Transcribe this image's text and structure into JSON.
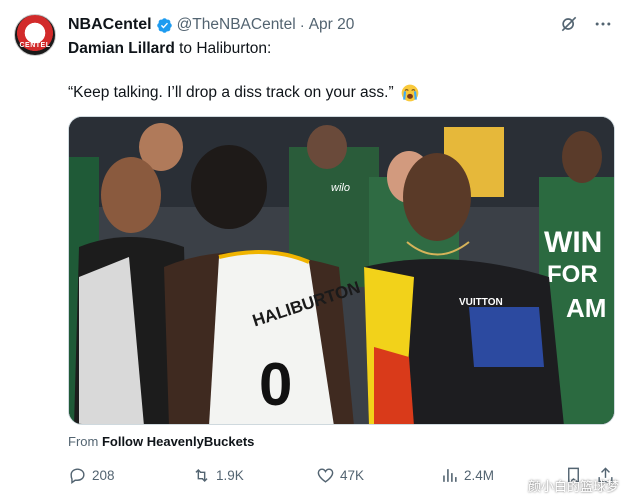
{
  "post": {
    "display_name": "NBACentel",
    "handle": "@TheNBACentel",
    "separator": "·",
    "time": "Apr 20",
    "avatar_text": "CENTEL",
    "line1_name": "Damian Lillard",
    "line1_rest": " to Haliburton:",
    "quote": "“Keep talking. I’ll drop a diss track on your ass.”",
    "emoji_icon": "loudly-crying-face-icon"
  },
  "media": {
    "jersey_name": "HALIBURTON",
    "jersey_number": "0",
    "shirt_brand": "VUITTON",
    "banner_text_1": "WIN",
    "banner_text_2": "FOR",
    "banner_text_3": "AM",
    "shirt_logo": "wilo"
  },
  "attribution": {
    "prefix": "From ",
    "source": "Follow HeavenlyBuckets"
  },
  "actions": {
    "replies": "208",
    "reposts": "1.9K",
    "likes": "47K",
    "views": "2.4M"
  },
  "watermark": "颜小白的篮球梦",
  "colors": {
    "verified": "#1d9bf0",
    "secondary_text": "#536471",
    "primary_text": "#0f1419"
  }
}
